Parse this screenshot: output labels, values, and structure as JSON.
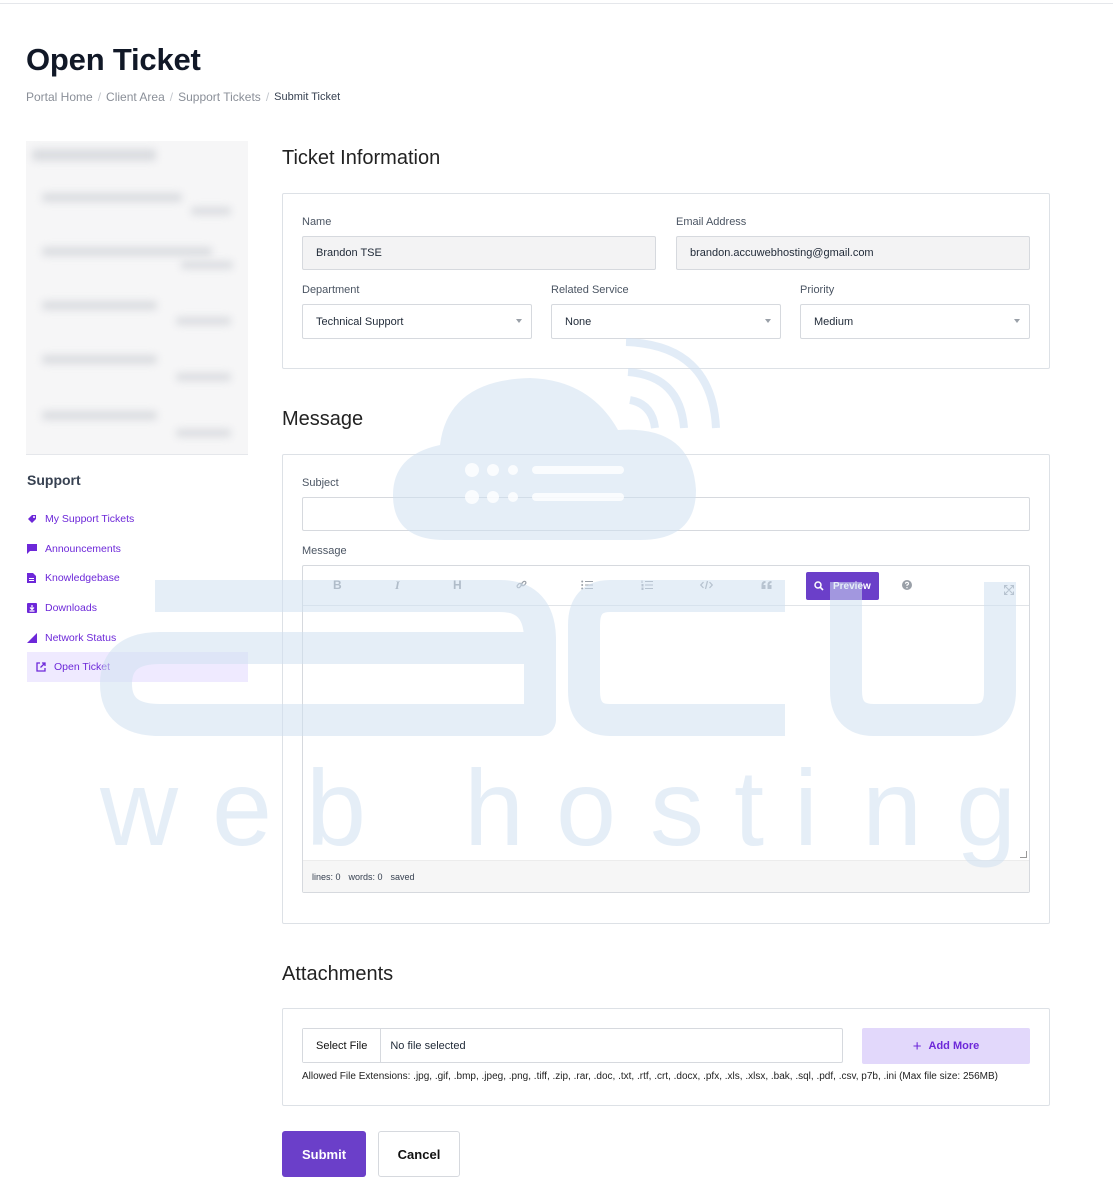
{
  "page": {
    "title": "Open Ticket",
    "breadcrumb": [
      "Portal Home",
      "Client Area",
      "Support Tickets",
      "Submit Ticket"
    ]
  },
  "sidebar": {
    "heading": "Support",
    "items": [
      {
        "label": "My Support Tickets",
        "icon": "ticket-icon"
      },
      {
        "label": "Announcements",
        "icon": "comment-icon"
      },
      {
        "label": "Knowledgebase",
        "icon": "book-icon"
      },
      {
        "label": "Downloads",
        "icon": "download-icon"
      },
      {
        "label": "Network Status",
        "icon": "signal-icon"
      },
      {
        "label": "Open Ticket",
        "icon": "external-link-icon",
        "active": true
      }
    ]
  },
  "ticket_info": {
    "title": "Ticket Information",
    "name_label": "Name",
    "name_value": "Brandon TSE",
    "email_label": "Email Address",
    "email_value": "brandon.accuwebhosting@gmail.com",
    "department_label": "Department",
    "department_value": "Technical Support",
    "service_label": "Related Service",
    "service_value": "None",
    "priority_label": "Priority",
    "priority_value": "Medium"
  },
  "message": {
    "title": "Message",
    "subject_label": "Subject",
    "subject_value": "",
    "message_label": "Message",
    "toolbar": {
      "bold": "B",
      "italic": "I",
      "heading": "H",
      "preview": "Preview"
    },
    "footer": {
      "lines": "lines: 0",
      "words": "words: 0",
      "saved": "saved"
    }
  },
  "attachments": {
    "title": "Attachments",
    "select_file": "Select File",
    "no_file": "No file selected",
    "add_more": "Add More",
    "allowed": "Allowed File Extensions: .jpg, .gif, .bmp, .jpeg, .png, .tiff, .zip, .rar, .doc, .txt, .rtf, .crt, .docx, .pfx, .xls, .xlsx, .bak, .sql, .pdf, .csv, p7b, .ini (Max file size: 256MB)"
  },
  "actions": {
    "submit": "Submit",
    "cancel": "Cancel"
  },
  "colors": {
    "accent": "#6b3fc9",
    "accent_light": "#e2d8fb",
    "link": "#6d28d9",
    "watermark": "#cfe0f1"
  }
}
